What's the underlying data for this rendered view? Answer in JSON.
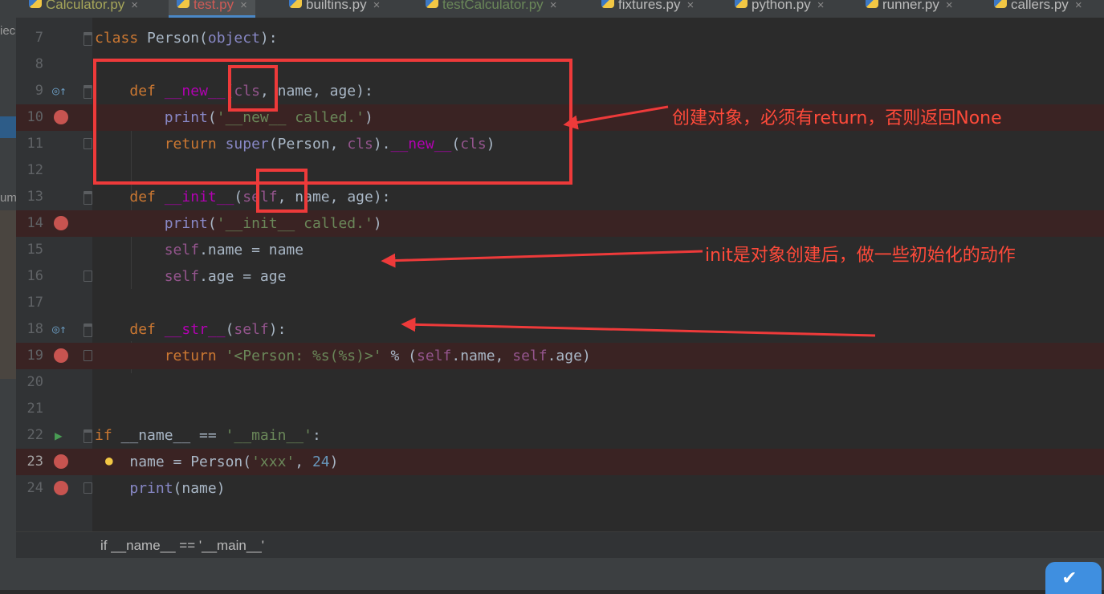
{
  "tabs": [
    {
      "label": "Calculator.py",
      "close": "×"
    },
    {
      "label": "test.py",
      "close": "×"
    },
    {
      "label": "builtins.py",
      "close": "×"
    },
    {
      "label": "testCalculator.py",
      "close": "×"
    },
    {
      "label": "fixtures.py",
      "close": "×"
    },
    {
      "label": "python.py",
      "close": "×"
    },
    {
      "label": "runner.py",
      "close": "×"
    },
    {
      "label": "callers.py",
      "close": "×"
    }
  ],
  "left_strip": {
    "frag1": "iec",
    "frag2": "um"
  },
  "lines": [
    {
      "num": "7"
    },
    {
      "num": "8"
    },
    {
      "num": "9"
    },
    {
      "num": "10"
    },
    {
      "num": "11"
    },
    {
      "num": "12"
    },
    {
      "num": "13"
    },
    {
      "num": "14"
    },
    {
      "num": "15"
    },
    {
      "num": "16"
    },
    {
      "num": "17"
    },
    {
      "num": "18"
    },
    {
      "num": "19"
    },
    {
      "num": "20"
    },
    {
      "num": "21"
    },
    {
      "num": "22"
    },
    {
      "num": "23"
    },
    {
      "num": "24"
    }
  ],
  "code": {
    "l7": {
      "kw": "class",
      "name": " Person(",
      "base": "object",
      "end": "):"
    },
    "l9": {
      "indent": "    ",
      "kw": "def",
      "sp": " ",
      "fn": "__new__",
      "p1": "(",
      "cls": "cls",
      "rest": ", name, age):"
    },
    "l10": {
      "indent": "        ",
      "bi": "print",
      "p": "(",
      "str": "'__new__ called.'",
      "end": ")"
    },
    "l11": {
      "indent": "        ",
      "kw": "return",
      "sp": " ",
      "bi": "super",
      "a": "(Person, ",
      "cls": "cls",
      "b": ").",
      "magic": "__new__",
      "c": "(",
      "cls2": "cls",
      "d": ")"
    },
    "l13": {
      "indent": "    ",
      "kw": "def",
      "sp": " ",
      "fn": "__init__",
      "p1": "(",
      "self": "self",
      "rest": ", name, age):"
    },
    "l14": {
      "indent": "        ",
      "bi": "print",
      "p": "(",
      "str": "'__init__ called.'",
      "end": ")"
    },
    "l15": {
      "indent": "        ",
      "self": "self",
      "rest": ".name = name"
    },
    "l16": {
      "indent": "        ",
      "self": "self",
      "rest": ".age = age"
    },
    "l18": {
      "indent": "    ",
      "kw": "def",
      "sp": " ",
      "fn": "__str__",
      "p1": "(",
      "self": "self",
      "rest": "):"
    },
    "l19": {
      "indent": "        ",
      "kw": "return",
      "sp": " ",
      "str": "'<Person: %s(%s)>'",
      "a": " % (",
      "self": "self",
      "b": ".name, ",
      "self2": "self",
      "c": ".age)"
    },
    "l22": {
      "kw": "if",
      "a": " __name__ == ",
      "str": "'__main__'",
      "b": ":"
    },
    "l23": {
      "indent": "    ",
      "a": "name = Person(",
      "str": "'xxx'",
      "b": ", ",
      "num": "24",
      "c": ")"
    },
    "l24": {
      "indent": "    ",
      "bi": "print",
      "a": "(name)"
    }
  },
  "breadcrumb": "if __name__ == '__main__'",
  "annotations": {
    "new_note": "创建对象，必须有return，否则返回None",
    "init_note": "init是对象创建后，做一些初始化的动作"
  },
  "colors": {
    "annotation": "#ff4a3a",
    "breakpoint": "#c75450",
    "keyword": "#cc7832"
  },
  "icons": {
    "badge": "check-badge-icon"
  }
}
